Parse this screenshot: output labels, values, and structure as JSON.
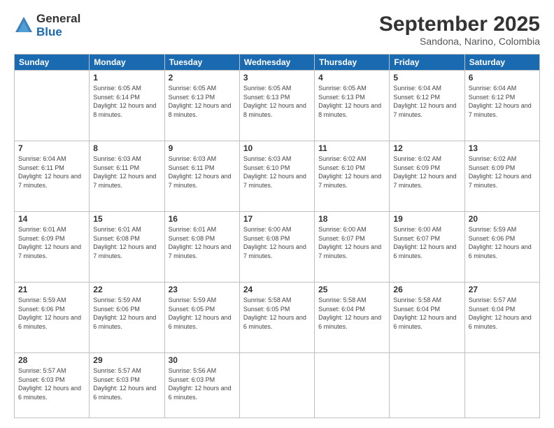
{
  "logo": {
    "general": "General",
    "blue": "Blue"
  },
  "header": {
    "month": "September 2025",
    "location": "Sandona, Narino, Colombia"
  },
  "weekdays": [
    "Sunday",
    "Monday",
    "Tuesday",
    "Wednesday",
    "Thursday",
    "Friday",
    "Saturday"
  ],
  "weeks": [
    [
      {
        "day": "",
        "sunrise": "",
        "sunset": "",
        "daylight": ""
      },
      {
        "day": "1",
        "sunrise": "Sunrise: 6:05 AM",
        "sunset": "Sunset: 6:14 PM",
        "daylight": "Daylight: 12 hours and 8 minutes."
      },
      {
        "day": "2",
        "sunrise": "Sunrise: 6:05 AM",
        "sunset": "Sunset: 6:13 PM",
        "daylight": "Daylight: 12 hours and 8 minutes."
      },
      {
        "day": "3",
        "sunrise": "Sunrise: 6:05 AM",
        "sunset": "Sunset: 6:13 PM",
        "daylight": "Daylight: 12 hours and 8 minutes."
      },
      {
        "day": "4",
        "sunrise": "Sunrise: 6:05 AM",
        "sunset": "Sunset: 6:13 PM",
        "daylight": "Daylight: 12 hours and 8 minutes."
      },
      {
        "day": "5",
        "sunrise": "Sunrise: 6:04 AM",
        "sunset": "Sunset: 6:12 PM",
        "daylight": "Daylight: 12 hours and 7 minutes."
      },
      {
        "day": "6",
        "sunrise": "Sunrise: 6:04 AM",
        "sunset": "Sunset: 6:12 PM",
        "daylight": "Daylight: 12 hours and 7 minutes."
      }
    ],
    [
      {
        "day": "7",
        "sunrise": "Sunrise: 6:04 AM",
        "sunset": "Sunset: 6:11 PM",
        "daylight": "Daylight: 12 hours and 7 minutes."
      },
      {
        "day": "8",
        "sunrise": "Sunrise: 6:03 AM",
        "sunset": "Sunset: 6:11 PM",
        "daylight": "Daylight: 12 hours and 7 minutes."
      },
      {
        "day": "9",
        "sunrise": "Sunrise: 6:03 AM",
        "sunset": "Sunset: 6:11 PM",
        "daylight": "Daylight: 12 hours and 7 minutes."
      },
      {
        "day": "10",
        "sunrise": "Sunrise: 6:03 AM",
        "sunset": "Sunset: 6:10 PM",
        "daylight": "Daylight: 12 hours and 7 minutes."
      },
      {
        "day": "11",
        "sunrise": "Sunrise: 6:02 AM",
        "sunset": "Sunset: 6:10 PM",
        "daylight": "Daylight: 12 hours and 7 minutes."
      },
      {
        "day": "12",
        "sunrise": "Sunrise: 6:02 AM",
        "sunset": "Sunset: 6:09 PM",
        "daylight": "Daylight: 12 hours and 7 minutes."
      },
      {
        "day": "13",
        "sunrise": "Sunrise: 6:02 AM",
        "sunset": "Sunset: 6:09 PM",
        "daylight": "Daylight: 12 hours and 7 minutes."
      }
    ],
    [
      {
        "day": "14",
        "sunrise": "Sunrise: 6:01 AM",
        "sunset": "Sunset: 6:09 PM",
        "daylight": "Daylight: 12 hours and 7 minutes."
      },
      {
        "day": "15",
        "sunrise": "Sunrise: 6:01 AM",
        "sunset": "Sunset: 6:08 PM",
        "daylight": "Daylight: 12 hours and 7 minutes."
      },
      {
        "day": "16",
        "sunrise": "Sunrise: 6:01 AM",
        "sunset": "Sunset: 6:08 PM",
        "daylight": "Daylight: 12 hours and 7 minutes."
      },
      {
        "day": "17",
        "sunrise": "Sunrise: 6:00 AM",
        "sunset": "Sunset: 6:08 PM",
        "daylight": "Daylight: 12 hours and 7 minutes."
      },
      {
        "day": "18",
        "sunrise": "Sunrise: 6:00 AM",
        "sunset": "Sunset: 6:07 PM",
        "daylight": "Daylight: 12 hours and 7 minutes."
      },
      {
        "day": "19",
        "sunrise": "Sunrise: 6:00 AM",
        "sunset": "Sunset: 6:07 PM",
        "daylight": "Daylight: 12 hours and 6 minutes."
      },
      {
        "day": "20",
        "sunrise": "Sunrise: 5:59 AM",
        "sunset": "Sunset: 6:06 PM",
        "daylight": "Daylight: 12 hours and 6 minutes."
      }
    ],
    [
      {
        "day": "21",
        "sunrise": "Sunrise: 5:59 AM",
        "sunset": "Sunset: 6:06 PM",
        "daylight": "Daylight: 12 hours and 6 minutes."
      },
      {
        "day": "22",
        "sunrise": "Sunrise: 5:59 AM",
        "sunset": "Sunset: 6:06 PM",
        "daylight": "Daylight: 12 hours and 6 minutes."
      },
      {
        "day": "23",
        "sunrise": "Sunrise: 5:59 AM",
        "sunset": "Sunset: 6:05 PM",
        "daylight": "Daylight: 12 hours and 6 minutes."
      },
      {
        "day": "24",
        "sunrise": "Sunrise: 5:58 AM",
        "sunset": "Sunset: 6:05 PM",
        "daylight": "Daylight: 12 hours and 6 minutes."
      },
      {
        "day": "25",
        "sunrise": "Sunrise: 5:58 AM",
        "sunset": "Sunset: 6:04 PM",
        "daylight": "Daylight: 12 hours and 6 minutes."
      },
      {
        "day": "26",
        "sunrise": "Sunrise: 5:58 AM",
        "sunset": "Sunset: 6:04 PM",
        "daylight": "Daylight: 12 hours and 6 minutes."
      },
      {
        "day": "27",
        "sunrise": "Sunrise: 5:57 AM",
        "sunset": "Sunset: 6:04 PM",
        "daylight": "Daylight: 12 hours and 6 minutes."
      }
    ],
    [
      {
        "day": "28",
        "sunrise": "Sunrise: 5:57 AM",
        "sunset": "Sunset: 6:03 PM",
        "daylight": "Daylight: 12 hours and 6 minutes."
      },
      {
        "day": "29",
        "sunrise": "Sunrise: 5:57 AM",
        "sunset": "Sunset: 6:03 PM",
        "daylight": "Daylight: 12 hours and 6 minutes."
      },
      {
        "day": "30",
        "sunrise": "Sunrise: 5:56 AM",
        "sunset": "Sunset: 6:03 PM",
        "daylight": "Daylight: 12 hours and 6 minutes."
      },
      {
        "day": "",
        "sunrise": "",
        "sunset": "",
        "daylight": ""
      },
      {
        "day": "",
        "sunrise": "",
        "sunset": "",
        "daylight": ""
      },
      {
        "day": "",
        "sunrise": "",
        "sunset": "",
        "daylight": ""
      },
      {
        "day": "",
        "sunrise": "",
        "sunset": "",
        "daylight": ""
      }
    ]
  ]
}
